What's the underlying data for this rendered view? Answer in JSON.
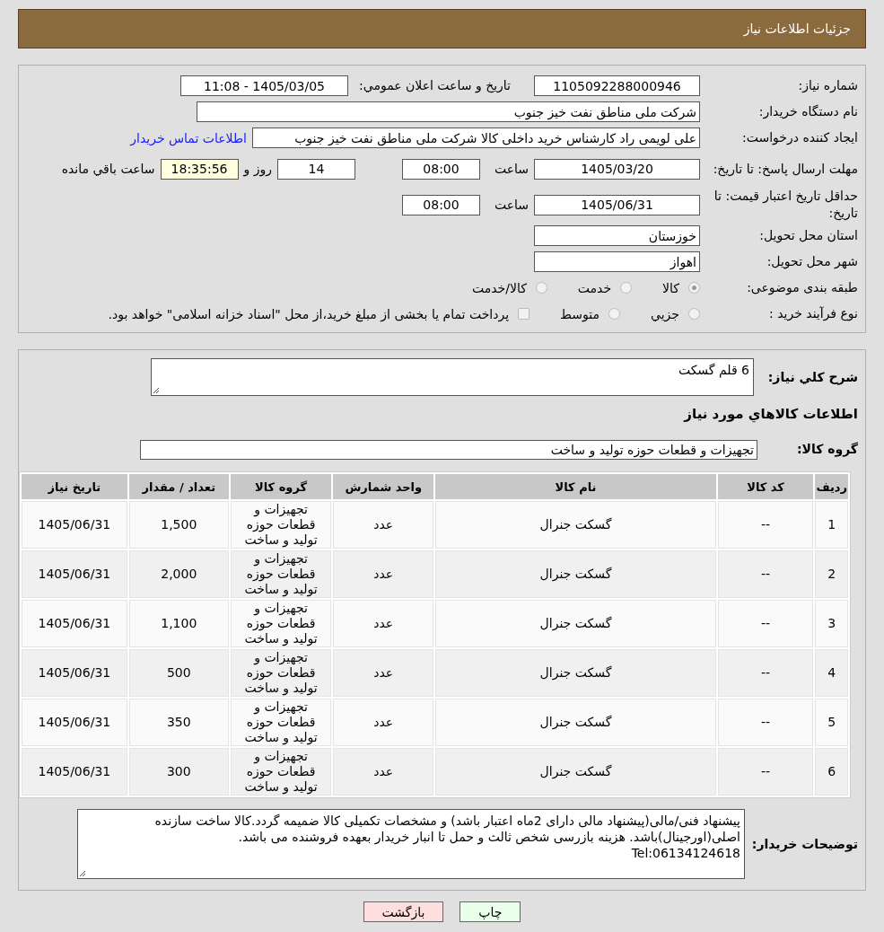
{
  "header": {
    "title": "جزئیات اطلاعات نیاز"
  },
  "need_number": {
    "label": "شماره نیاز:",
    "value": "1105092288000946"
  },
  "announce": {
    "label": "تاریخ و ساعت اعلان عمومي:",
    "value": "1405/03/05 - 11:08"
  },
  "buyer": {
    "label": "نام دستگاه خریدار:",
    "value": "شرکت ملی مناطق نفت خیز جنوب"
  },
  "requester": {
    "label": "ایجاد کننده درخواست:",
    "value": "علی  لویمی راد  کارشناس خرید داخلی کالا شرکت ملی مناطق نفت خیز جنوب",
    "link": "اطلاعات تماس خریدار"
  },
  "deadline": {
    "label": "مهلت ارسال پاسخ: تا تاریخ:",
    "date": "1405/03/20",
    "time_label": "ساعت",
    "time": "08:00",
    "days": "14",
    "days_label": "روز و",
    "remaining": "18:35:56",
    "remaining_label": "ساعت باقي مانده"
  },
  "validity": {
    "label": "حداقل تاریخ اعتبار قیمت: تا تاریخ:",
    "date": "1405/06/31",
    "time_label": "ساعت",
    "time": "08:00"
  },
  "province": {
    "label": "استان محل تحویل:",
    "value": "خوزستان"
  },
  "city": {
    "label": "شهر محل تحویل:",
    "value": "اهواز"
  },
  "category": {
    "label": "طبقه بندی موضوعی:",
    "options": [
      {
        "kind": "radio",
        "label": "کالا",
        "selected": true
      },
      {
        "kind": "radio",
        "label": "خدمت",
        "selected": false
      },
      {
        "kind": "radio",
        "label": "کالا/خدمت",
        "selected": false
      }
    ]
  },
  "process": {
    "label": "نوع فرآیند خرید :",
    "options": [
      {
        "kind": "radio",
        "label": "جزيي",
        "selected": false
      },
      {
        "kind": "radio",
        "label": "متوسط",
        "selected": false
      },
      {
        "kind": "checkbox",
        "label": "پرداخت تمام یا بخشی از مبلغ خرید،از محل \"اسناد خزانه اسلامی\" خواهد بود.",
        "selected": false
      }
    ]
  },
  "summary": {
    "label": "شرح كلي نیاز:",
    "value": "6 قلم گسکت"
  },
  "items_title": "اطلاعات كالاهاي مورد نیاز",
  "group": {
    "label": "گروه کالا:",
    "value": "تجهیزات و قطعات حوزه تولید و ساخت"
  },
  "table": {
    "columns": [
      "ردیف",
      "کد کالا",
      "نام کالا",
      "واحد شمارش",
      "گروه کالا",
      "تعداد / مقدار",
      "تاریخ نیاز"
    ],
    "rows": [
      [
        "1",
        "--",
        "گسکت جنرال",
        "عدد",
        "تجهیزات و قطعات حوزه تولید و ساخت",
        "1,500",
        "1405/06/31"
      ],
      [
        "2",
        "--",
        "گسکت جنرال",
        "عدد",
        "تجهیزات و قطعات حوزه تولید و ساخت",
        "2,000",
        "1405/06/31"
      ],
      [
        "3",
        "--",
        "گسکت جنرال",
        "عدد",
        "تجهیزات و قطعات حوزه تولید و ساخت",
        "1,100",
        "1405/06/31"
      ],
      [
        "4",
        "--",
        "گسکت جنرال",
        "عدد",
        "تجهیزات و قطعات حوزه تولید و ساخت",
        "500",
        "1405/06/31"
      ],
      [
        "5",
        "--",
        "گسکت جنرال",
        "عدد",
        "تجهیزات و قطعات حوزه تولید و ساخت",
        "350",
        "1405/06/31"
      ],
      [
        "6",
        "--",
        "گسکت جنرال",
        "عدد",
        "تجهیزات و قطعات حوزه تولید و ساخت",
        "300",
        "1405/06/31"
      ]
    ]
  },
  "notes": {
    "label": "توضیحات خریدار:",
    "value": "پیشنهاد فنی/مالی(پیشنهاد مالی دارای 2ماه اعتبار باشد) و مشخصات تکمیلی کالا ضمیمه گردد.کالا ساخت سازنده اصلی(اورجینال)باشد. هزینه بازرسی شخص ثالث و حمل تا انبار خریدار بعهده فروشنده می باشد.\nTel:06134124618"
  },
  "buttons": [
    {
      "kind": "print",
      "label": "چاپ"
    },
    {
      "kind": "back",
      "label": "بازگشت"
    }
  ]
}
